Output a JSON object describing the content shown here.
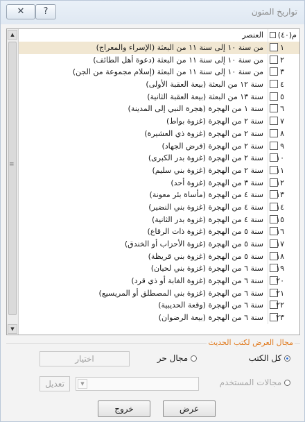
{
  "window": {
    "title": "تواريخ المتون",
    "close_icon": "close-icon",
    "help_icon": "help-icon"
  },
  "grid": {
    "header": {
      "count_label": "م(٤٠)",
      "name_label": "العنصر"
    },
    "rows": [
      {
        "num": "١",
        "text": "من سنة ١٠ إلى سنة ١١ من البعثة (الإسراء والمعراج)",
        "selected": true
      },
      {
        "num": "٢",
        "text": "من سنة ١٠ إلى سنة ١١ من البعثة (دعوة أهل الطائف)"
      },
      {
        "num": "٣",
        "text": "من سنة ١٠ إلى سنة ١١ من البعثة (إسلام مجموعة من الجن)"
      },
      {
        "num": "٤",
        "text": "سنة ١٢ من البعثة (بيعة العقبة الأولى)"
      },
      {
        "num": "٥",
        "text": "سنة ١٣ من البعثة (بيعة العقبة الثانية)"
      },
      {
        "num": "٦",
        "text": "سنة ١ من الهجرة (هجرة النبي إلى المدينة)"
      },
      {
        "num": "٧",
        "text": "سنة ٢ من الهجرة (غزوة بواط)"
      },
      {
        "num": "٨",
        "text": "سنة ٢ من الهجرة (غزوة ذي العشيرة)"
      },
      {
        "num": "٩",
        "text": "سنة ٢ من الهجرة (فرض الجهاد)"
      },
      {
        "num": "١٠",
        "text": "سنة ٢ من الهجرة (غزوة بدر الكبرى)"
      },
      {
        "num": "١١",
        "text": "سنة ٢ من الهجرة (غزوة بني سليم)"
      },
      {
        "num": "١٢",
        "text": "سنة ٣ من الهجرة (غزوة أحد)"
      },
      {
        "num": "١٣",
        "text": "سنة ٤ من الهجرة (مأساة بئر معونة)"
      },
      {
        "num": "١٤",
        "text": "سنة ٤ من الهجرة (غزوة بني النضير)"
      },
      {
        "num": "١٥",
        "text": "سنة ٤ من الهجرة (غزوة بدر الثانية)"
      },
      {
        "num": "١٦",
        "text": "سنة ٥ من الهجرة (غزوة ذات الرقاع)"
      },
      {
        "num": "١٧",
        "text": "سنة ٥ من الهجرة (غزوة الأحزاب أو الخندق)"
      },
      {
        "num": "١٨",
        "text": "سنة ٥ من الهجرة (غزوة بني قريظة)"
      },
      {
        "num": "١٩",
        "text": "سنة ٦ من الهجرة (غزوة بني لحيان)"
      },
      {
        "num": "٢٠",
        "text": "سنة ٦ من الهجرة (غزوة الغابة أو ذي قرد)"
      },
      {
        "num": "٢١",
        "text": "سنة ٦ من الهجرة (غزوة بني المصطلق أو المريسيع)"
      },
      {
        "num": "٢٢",
        "text": "سنة ٦ من الهجرة (وقعة الحديبية)"
      },
      {
        "num": "٢٣",
        "text": "سنة ٦ من الهجرة (بيعة الرضوان)"
      }
    ]
  },
  "display_group": {
    "label": "مجال العرض لكتب الحديث",
    "radio_all": "كل الكتب",
    "radio_free": "مجال حر",
    "radio_user": "مجالات المستخدم",
    "choose_button": "اختيار",
    "edit_button": "تعديل"
  },
  "footer": {
    "show_button": "عرض",
    "exit_button": "خروج"
  }
}
